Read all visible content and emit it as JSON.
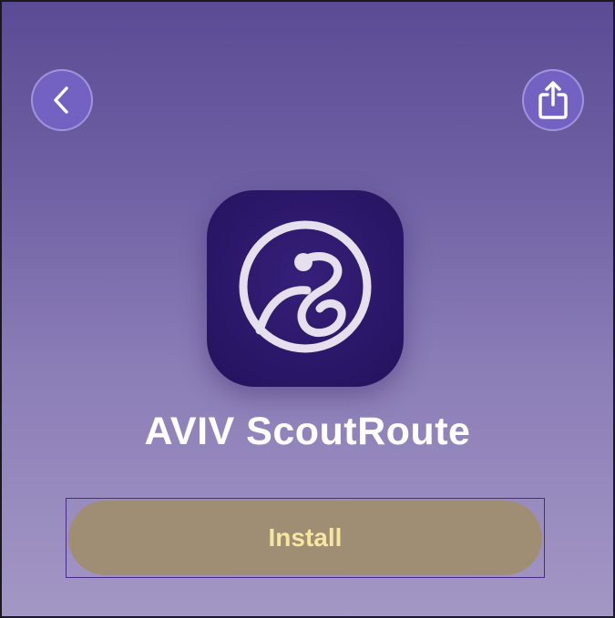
{
  "header": {
    "back_icon": "chevron-left-icon",
    "share_icon": "share-icon"
  },
  "app": {
    "icon": "scoutroute-logo-icon",
    "name": "AVIV ScoutRoute"
  },
  "actions": {
    "install_label": "Install"
  },
  "colors": {
    "background_top": "#5b4b95",
    "background_bottom": "#a397c5",
    "round_button": "#7462c2",
    "app_icon": "#2b1768",
    "install_button": "#a08e74",
    "install_text": "#f7e6a2"
  }
}
